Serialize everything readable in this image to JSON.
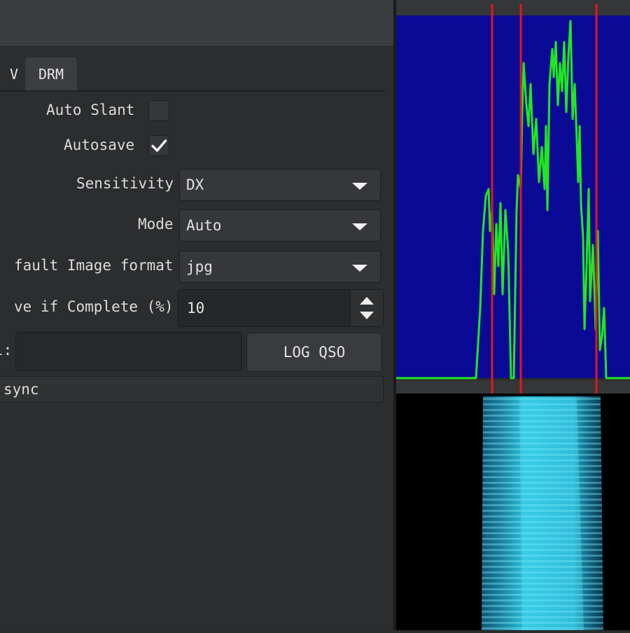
{
  "tabs": {
    "sstv": "V",
    "drm": "DRM"
  },
  "form": {
    "auto_slant": {
      "label": "Auto Slant",
      "checked": false
    },
    "autosave": {
      "label": "Autosave",
      "checked": true
    },
    "sensitivity": {
      "label": "Sensitivity",
      "value": "DX"
    },
    "mode": {
      "label": "Mode",
      "value": "Auto"
    },
    "image_format": {
      "label": "fault Image format",
      "value": "jpg"
    },
    "save_complete": {
      "label": "ve if Complete (%)",
      "value": "10"
    },
    "callsign": {
      "label": "l:",
      "value": ""
    },
    "log_button": "LOG QSO"
  },
  "status": {
    "text": "sync"
  },
  "spectrum": {
    "background": "#0a0a96",
    "trace_color": "#22e61f",
    "marker_color": "#e0181e"
  },
  "waterfall": {
    "background": "#000000",
    "signal_color": "#2fd4ef"
  }
}
